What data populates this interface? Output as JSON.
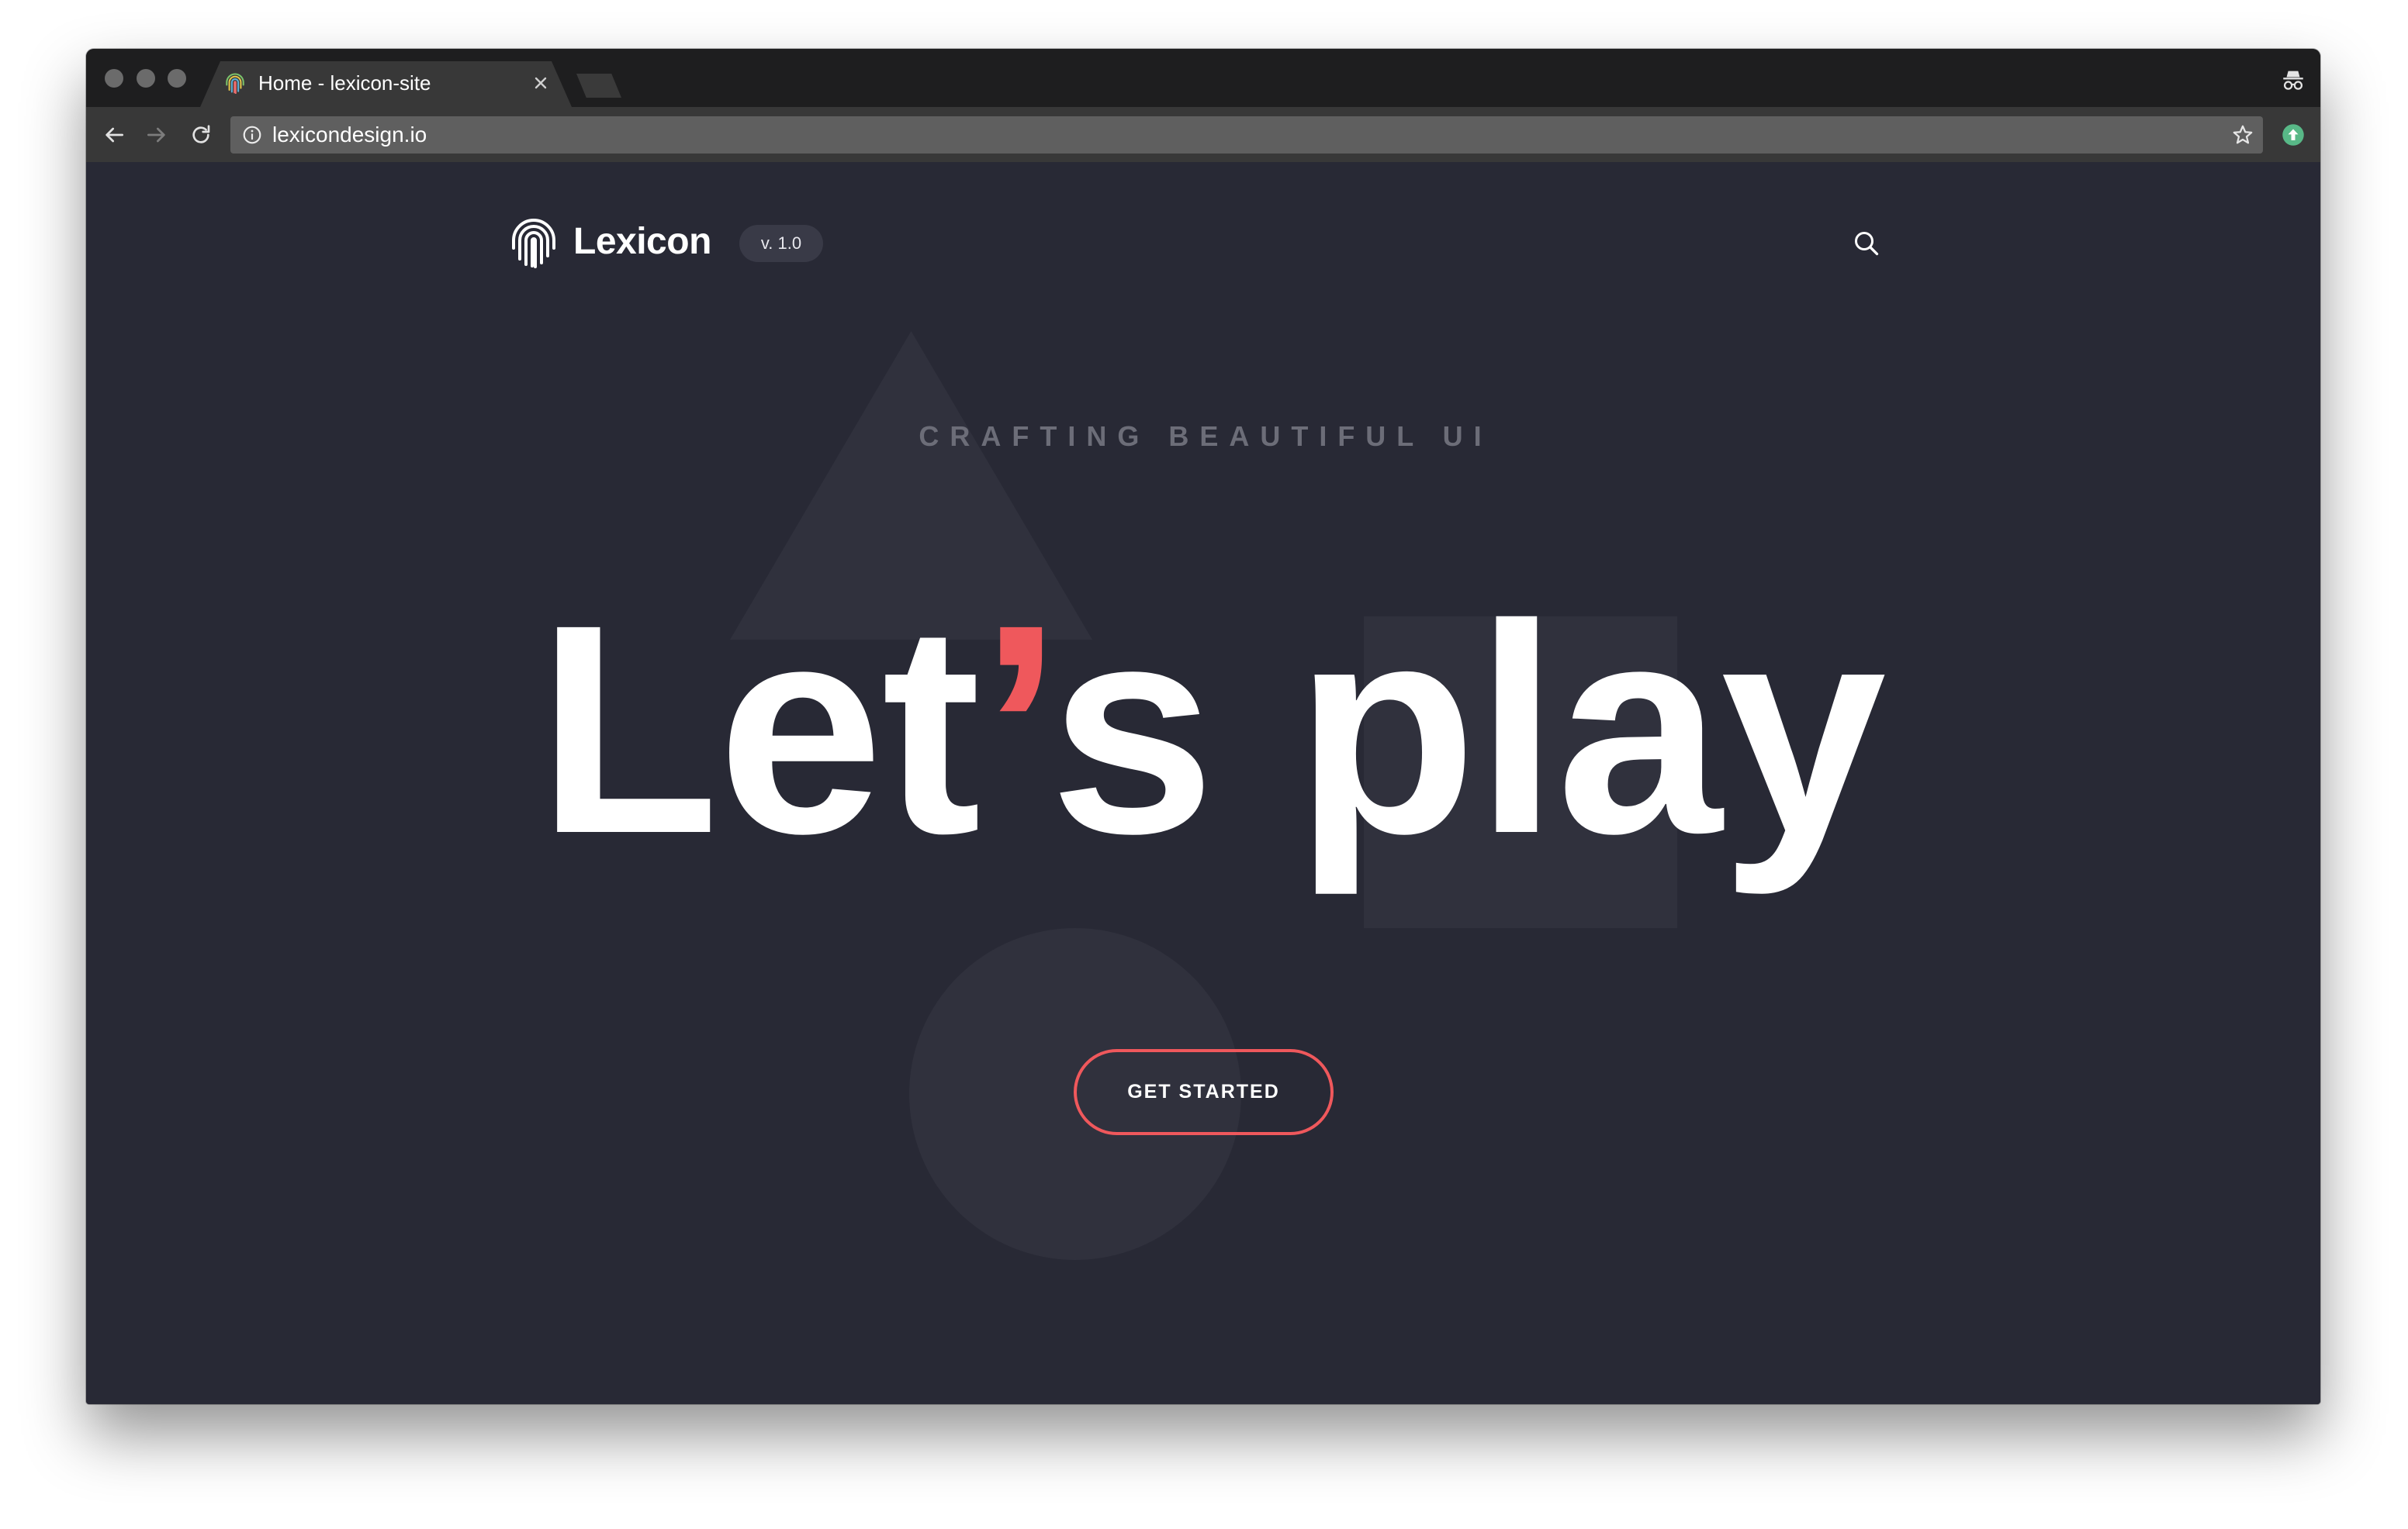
{
  "browser": {
    "window_controls": [
      "close",
      "minimize",
      "zoom"
    ],
    "tab": {
      "title": "Home - lexicon-site",
      "favicon": "lexicon-fingerprint-icon",
      "close_icon": "close-icon"
    },
    "new_tab_icon": "new-tab-icon",
    "incognito_icon": "incognito-icon",
    "toolbar": {
      "back_icon": "back-arrow-icon",
      "forward_icon": "forward-arrow-icon",
      "forward_enabled": false,
      "reload_icon": "reload-icon",
      "extension_icon": "extension-update-icon"
    },
    "address": {
      "url": "lexicondesign.io",
      "info_icon": "info-icon",
      "bookmark_icon": "star-icon"
    }
  },
  "site": {
    "brand": {
      "logo_icon": "fingerprint-logo-icon",
      "name": "Lexicon",
      "version": "v. 1.0"
    },
    "search_icon": "search-icon",
    "hero": {
      "eyebrow": "CRAFTING BEAUTIFUL UI",
      "headline_before": "Let",
      "headline_apostrophe": "’",
      "headline_after": "s play",
      "cta_label": "GET STARTED",
      "background_shapes": [
        "triangle",
        "square",
        "circle"
      ]
    }
  },
  "colors": {
    "page-bg": "#282935",
    "shape": "#30313d",
    "accent": "#ef585c",
    "tabstrip": "#1e1e1f",
    "toolbar": "#383838",
    "urlbar": "#5f5f5f",
    "badge": "#393a47",
    "eyebrow": "#6c6d78"
  }
}
